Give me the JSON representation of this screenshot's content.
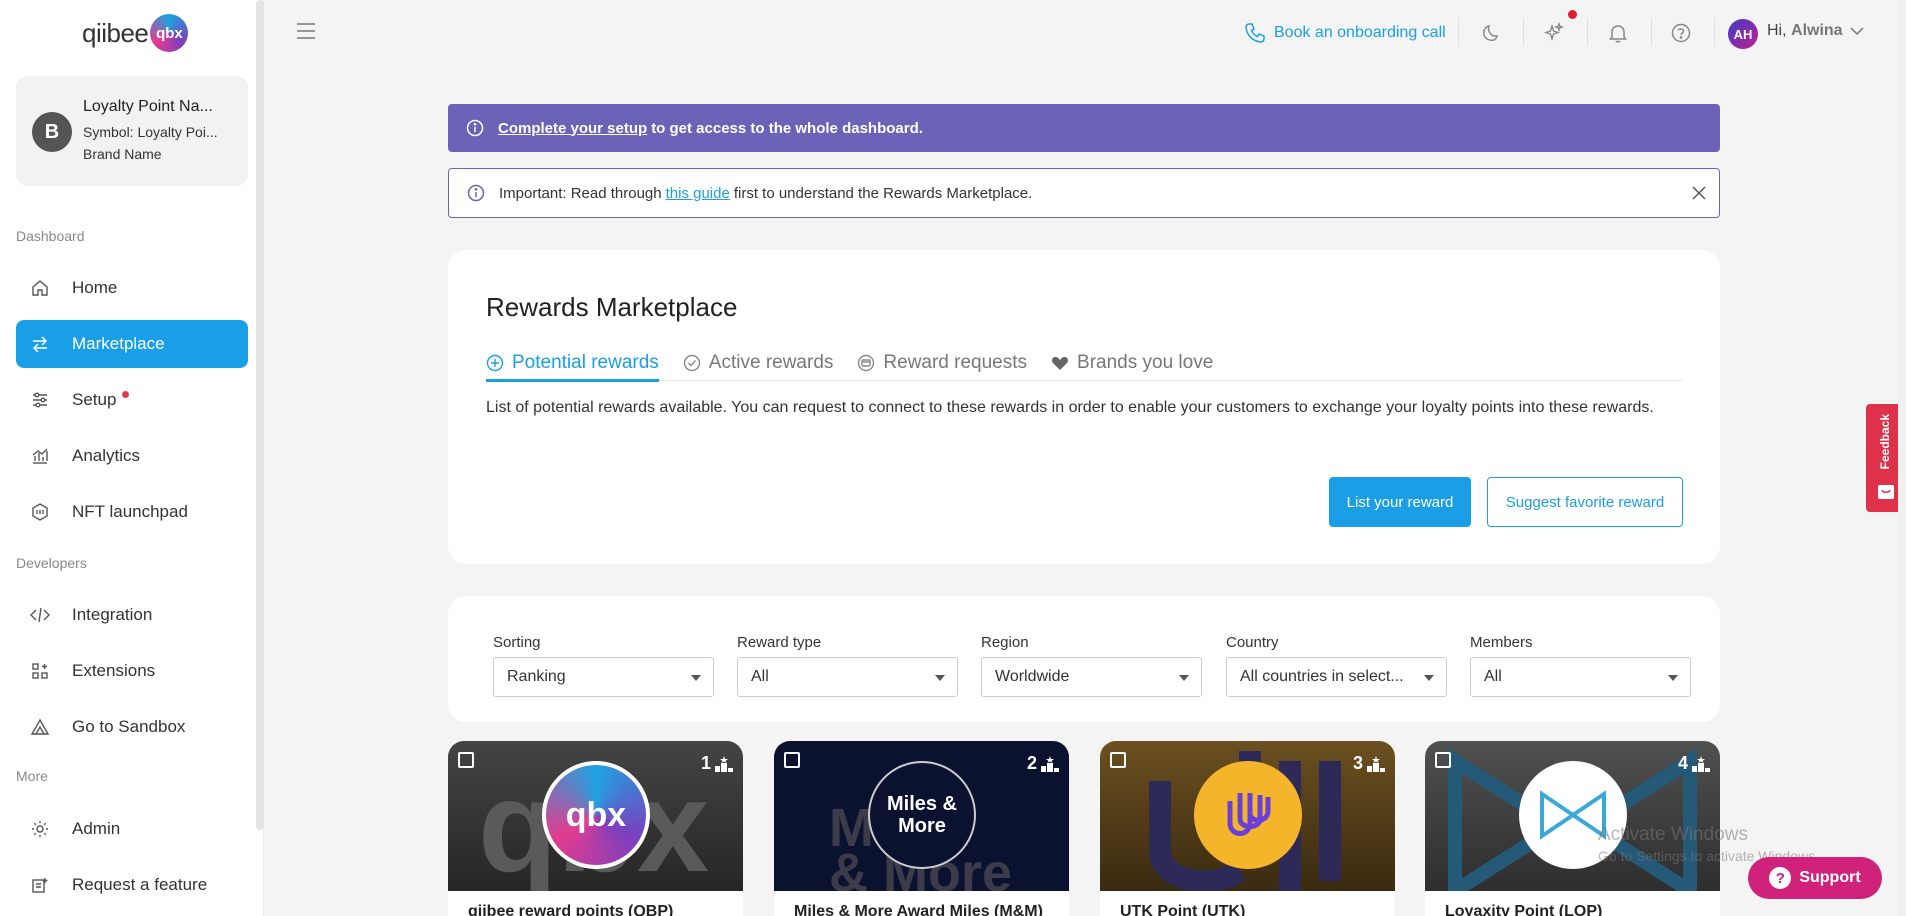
{
  "app": {
    "logo_text": "qiibee",
    "logo_mark": "qbx"
  },
  "brand": {
    "initial": "B",
    "name": "Loyalty Point Na...",
    "symbol": "Symbol: Loyalty Poi...",
    "sub": "Brand Name"
  },
  "sidebar": {
    "sections": {
      "dashboard": "Dashboard",
      "developers": "Developers",
      "more": "More"
    },
    "items": [
      {
        "label": "Home",
        "icon": "home-icon"
      },
      {
        "label": "Marketplace",
        "icon": "swap-arrows-icon",
        "active": true
      },
      {
        "label": "Setup",
        "icon": "sliders-icon",
        "badge": true
      },
      {
        "label": "Analytics",
        "icon": "analytics-icon"
      },
      {
        "label": "NFT launchpad",
        "icon": "nft-icon"
      },
      {
        "label": "Integration",
        "icon": "code-icon"
      },
      {
        "label": "Extensions",
        "icon": "extensions-icon"
      },
      {
        "label": "Go to Sandbox",
        "icon": "sandbox-icon"
      },
      {
        "label": "Admin",
        "icon": "gear-icon"
      },
      {
        "label": "Request a feature",
        "icon": "request-feature-icon"
      }
    ]
  },
  "header": {
    "onboarding_label": "Book an onboarding call",
    "user_initials": "AH",
    "greeting": "Hi,",
    "user_name": "Alwina"
  },
  "banners": {
    "setup_link": "Complete your setup",
    "setup_rest": "to get access to the whole dashboard.",
    "guide_before": "Important: Read through",
    "guide_link": "this guide",
    "guide_after": "first to understand the Rewards Marketplace."
  },
  "marketplace": {
    "title": "Rewards Marketplace",
    "tabs": [
      {
        "label": "Potential rewards",
        "icon": "plus-circle-icon",
        "active": true
      },
      {
        "label": "Active rewards",
        "icon": "check-circle-icon"
      },
      {
        "label": "Reward requests",
        "icon": "request-icon"
      },
      {
        "label": "Brands you love",
        "icon": "heart-icon"
      }
    ],
    "description": "List of potential rewards available. You can request to connect to these rewards in order to enable your customers to exchange your loyalty points into these rewards.",
    "list_button": "List your reward",
    "suggest_button": "Suggest favorite reward"
  },
  "filters": [
    {
      "label": "Sorting",
      "value": "Ranking"
    },
    {
      "label": "Reward type",
      "value": "All"
    },
    {
      "label": "Region",
      "value": "Worldwide"
    },
    {
      "label": "Country",
      "value": "All countries in select..."
    },
    {
      "label": "Members",
      "value": "All"
    }
  ],
  "rewards": [
    {
      "rank": "1",
      "name": "qiibee reward points (QBP)",
      "logo": "qbx"
    },
    {
      "rank": "2",
      "name": "Miles & More Award Miles (M&M)",
      "logo": "Miles & More"
    },
    {
      "rank": "3",
      "name": "UTK Point (UTK)",
      "logo": "UTK"
    },
    {
      "rank": "4",
      "name": "Loyaxity Point (LOP)",
      "logo": "LOP"
    }
  ],
  "feedback_label": "Feedback",
  "watermark": {
    "line1": "Activate Windows",
    "line2": "Go to Settings to activate Windows."
  },
  "support_label": "Support",
  "colors": {
    "accent": "#1a9ee5",
    "setup_banner": "#6b63b8",
    "support": "#d1227b",
    "feedback": "#e0314b"
  }
}
